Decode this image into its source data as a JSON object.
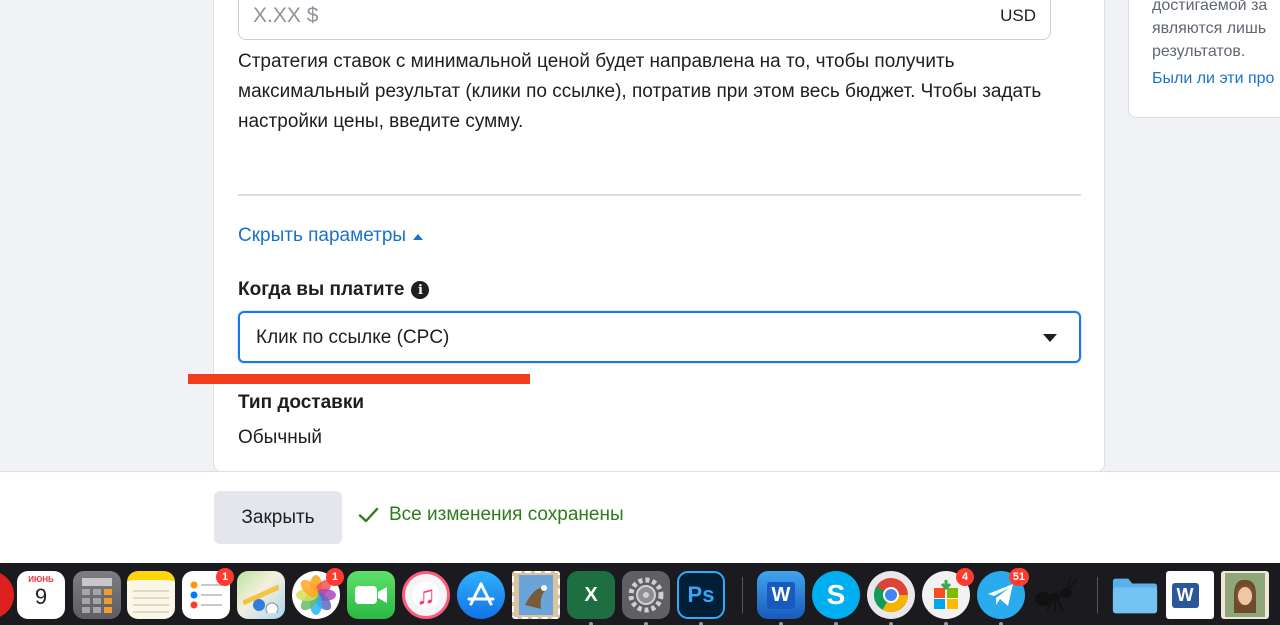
{
  "bid": {
    "placeholder": "X.XX $",
    "currency": "USD"
  },
  "strategy_text": "Стратегия ставок с минимальной ценой будет направлена на то, чтобы получить максимальный результат (клики по ссылке), потратив при этом весь бюджет. Чтобы задать настройки цены, введите сумму.",
  "hide_params_label": "Скрыть параметры",
  "when_pay": {
    "label": "Когда вы платите",
    "info_glyph": "i",
    "selected": "Клик по ссылке (CPC)"
  },
  "delivery": {
    "label": "Тип доставки",
    "value": "Обычный"
  },
  "side_panel": {
    "lines": [
      "достигаемой за",
      "являются лишь",
      "результатов."
    ],
    "link": "Были ли эти про"
  },
  "footer": {
    "close_label": "Закрыть",
    "saved_label": "Все изменения сохранены"
  },
  "dock": {
    "calendar_month": "ИЮНЬ",
    "calendar_day": "9",
    "items": [
      {
        "name": "calendar-icon",
        "color": "#ffffff",
        "badge": ""
      },
      {
        "name": "calculator-icon",
        "color": "#8e8e93",
        "badge": ""
      },
      {
        "name": "notes-icon",
        "color": "#ffd60a",
        "badge": ""
      },
      {
        "name": "reminders-icon",
        "color": "#ffffff",
        "badge": "1"
      },
      {
        "name": "maps-icon",
        "color": "#6cc04a",
        "badge": ""
      },
      {
        "name": "photos-icon",
        "color": "#ffffff",
        "badge": "1"
      },
      {
        "name": "facetime-icon",
        "color": "#34c759",
        "badge": ""
      },
      {
        "name": "itunes-icon",
        "color": "#fc5c7d",
        "badge": ""
      },
      {
        "name": "app-store-icon",
        "color": "#1e90ff",
        "badge": ""
      },
      {
        "name": "mail-stamp-icon",
        "color": "#c9a46b",
        "badge": ""
      },
      {
        "name": "excel-icon",
        "color": "#1d6f42",
        "badge": ""
      },
      {
        "name": "system-preferences-icon",
        "color": "#6e6e73",
        "badge": ""
      },
      {
        "name": "photoshop-icon",
        "color": "#001e36",
        "badge": ""
      },
      {
        "name": "word-icon",
        "color": "#2b579a",
        "badge": ""
      },
      {
        "name": "skype-icon",
        "color": "#00aff0",
        "badge": ""
      },
      {
        "name": "chrome-icon",
        "color": "#e8e8e8",
        "badge": ""
      },
      {
        "name": "office-installer-icon",
        "color": "#f0f0f0",
        "badge": "4"
      },
      {
        "name": "telegram-icon",
        "color": "#2aabee",
        "badge": "51"
      },
      {
        "name": "ant-app-icon",
        "color": "#1b1b1f",
        "badge": ""
      },
      {
        "name": "folder-icon",
        "color": "#5ab0e8",
        "badge": ""
      },
      {
        "name": "word-document-icon",
        "color": "#ffffff",
        "badge": ""
      },
      {
        "name": "photo-document-icon",
        "color": "#e6d3b3",
        "badge": ""
      }
    ],
    "labels": {
      "excel": "X",
      "photoshop": "Ps",
      "word": "W",
      "skype": "S",
      "word_doc": "W"
    }
  }
}
